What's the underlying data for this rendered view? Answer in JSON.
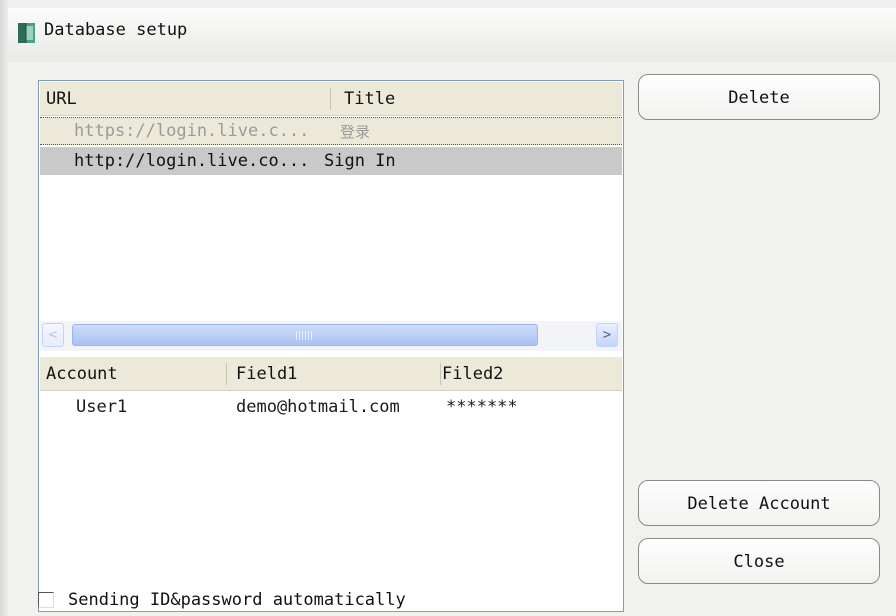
{
  "window": {
    "title": "Database setup"
  },
  "url_table": {
    "columns": [
      "URL",
      "Title"
    ],
    "rows": [
      {
        "url": "https://login.live.c...",
        "title": "登录",
        "state": "focused-dimmed"
      },
      {
        "url": "http://login.live.co...",
        "title": "Sign In",
        "state": "selected"
      }
    ],
    "scroll_left_glyph": "<",
    "scroll_right_glyph": ">"
  },
  "account_table": {
    "columns": [
      "Account",
      "Field1",
      "Filed2"
    ],
    "rows": [
      {
        "account": "User1",
        "field1": "demo@hotmail.com",
        "field2": "*******"
      }
    ]
  },
  "buttons": {
    "delete": "Delete",
    "delete_account": "Delete Account",
    "close": "Close"
  },
  "options": {
    "auto_send_label": "Sending ID&password automatically",
    "auto_send_checked": false
  },
  "icons": {
    "app": "database-book-icon"
  },
  "colors": {
    "header_bg": "#ece9d8",
    "selected_row": "#c9c9c9",
    "scrollbar": "#a9c1f2"
  }
}
